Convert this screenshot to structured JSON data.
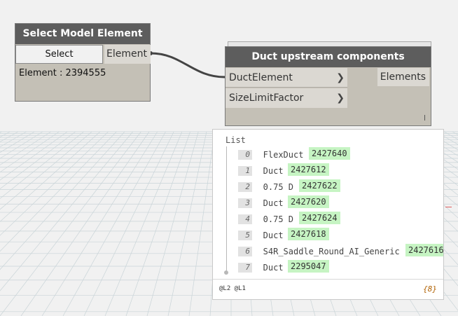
{
  "select_node": {
    "title": "Select Model Element",
    "button_label": "Select",
    "output_port": "Element",
    "value_text": "Element : 2394555"
  },
  "duct_node": {
    "title": "Duct upstream components",
    "inputs": [
      "DuctElement",
      "SizeLimitFactor"
    ],
    "output_port": "Elements",
    "lacing_mark": "l"
  },
  "preview": {
    "title": "List",
    "items": [
      {
        "index": "0",
        "type": "FlexDuct",
        "id": "2427640"
      },
      {
        "index": "1",
        "type": "Duct",
        "id": "2427612"
      },
      {
        "index": "2",
        "type": "0.75 D",
        "id": "2427622"
      },
      {
        "index": "3",
        "type": "Duct",
        "id": "2427620"
      },
      {
        "index": "4",
        "type": "0.75 D",
        "id": "2427624"
      },
      {
        "index": "5",
        "type": "Duct",
        "id": "2427618"
      },
      {
        "index": "6",
        "type": "S4R_Saddle_Round_AI_Generic",
        "id": "2427616"
      },
      {
        "index": "7",
        "type": "Duct",
        "id": "2295047"
      }
    ],
    "levels": "@L2 @L1",
    "count": "{8}"
  },
  "colors": {
    "node_header": "#5d5d5d",
    "node_body": "#c4c0b6",
    "port_bg": "#dbd8d2",
    "value_highlight": "#c6f4c3",
    "canvas_bg": "#f1f1f1",
    "grid": "#c9d4d8"
  },
  "icons": {
    "port_arrow": "chevron-right-icon"
  }
}
